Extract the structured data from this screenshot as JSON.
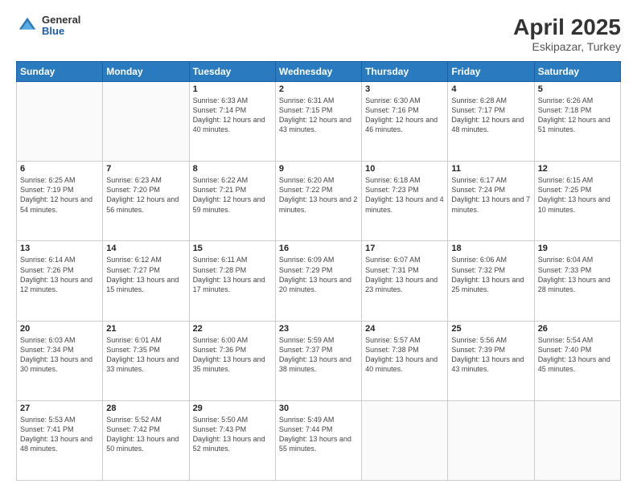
{
  "header": {
    "logo_general": "General",
    "logo_blue": "Blue",
    "title": "April 2025",
    "location": "Eskipazar, Turkey"
  },
  "days_of_week": [
    "Sunday",
    "Monday",
    "Tuesday",
    "Wednesday",
    "Thursday",
    "Friday",
    "Saturday"
  ],
  "weeks": [
    [
      {
        "day": "",
        "sunrise": "",
        "sunset": "",
        "daylight": ""
      },
      {
        "day": "",
        "sunrise": "",
        "sunset": "",
        "daylight": ""
      },
      {
        "day": "1",
        "sunrise": "Sunrise: 6:33 AM",
        "sunset": "Sunset: 7:14 PM",
        "daylight": "Daylight: 12 hours and 40 minutes."
      },
      {
        "day": "2",
        "sunrise": "Sunrise: 6:31 AM",
        "sunset": "Sunset: 7:15 PM",
        "daylight": "Daylight: 12 hours and 43 minutes."
      },
      {
        "day": "3",
        "sunrise": "Sunrise: 6:30 AM",
        "sunset": "Sunset: 7:16 PM",
        "daylight": "Daylight: 12 hours and 46 minutes."
      },
      {
        "day": "4",
        "sunrise": "Sunrise: 6:28 AM",
        "sunset": "Sunset: 7:17 PM",
        "daylight": "Daylight: 12 hours and 48 minutes."
      },
      {
        "day": "5",
        "sunrise": "Sunrise: 6:26 AM",
        "sunset": "Sunset: 7:18 PM",
        "daylight": "Daylight: 12 hours and 51 minutes."
      }
    ],
    [
      {
        "day": "6",
        "sunrise": "Sunrise: 6:25 AM",
        "sunset": "Sunset: 7:19 PM",
        "daylight": "Daylight: 12 hours and 54 minutes."
      },
      {
        "day": "7",
        "sunrise": "Sunrise: 6:23 AM",
        "sunset": "Sunset: 7:20 PM",
        "daylight": "Daylight: 12 hours and 56 minutes."
      },
      {
        "day": "8",
        "sunrise": "Sunrise: 6:22 AM",
        "sunset": "Sunset: 7:21 PM",
        "daylight": "Daylight: 12 hours and 59 minutes."
      },
      {
        "day": "9",
        "sunrise": "Sunrise: 6:20 AM",
        "sunset": "Sunset: 7:22 PM",
        "daylight": "Daylight: 13 hours and 2 minutes."
      },
      {
        "day": "10",
        "sunrise": "Sunrise: 6:18 AM",
        "sunset": "Sunset: 7:23 PM",
        "daylight": "Daylight: 13 hours and 4 minutes."
      },
      {
        "day": "11",
        "sunrise": "Sunrise: 6:17 AM",
        "sunset": "Sunset: 7:24 PM",
        "daylight": "Daylight: 13 hours and 7 minutes."
      },
      {
        "day": "12",
        "sunrise": "Sunrise: 6:15 AM",
        "sunset": "Sunset: 7:25 PM",
        "daylight": "Daylight: 13 hours and 10 minutes."
      }
    ],
    [
      {
        "day": "13",
        "sunrise": "Sunrise: 6:14 AM",
        "sunset": "Sunset: 7:26 PM",
        "daylight": "Daylight: 13 hours and 12 minutes."
      },
      {
        "day": "14",
        "sunrise": "Sunrise: 6:12 AM",
        "sunset": "Sunset: 7:27 PM",
        "daylight": "Daylight: 13 hours and 15 minutes."
      },
      {
        "day": "15",
        "sunrise": "Sunrise: 6:11 AM",
        "sunset": "Sunset: 7:28 PM",
        "daylight": "Daylight: 13 hours and 17 minutes."
      },
      {
        "day": "16",
        "sunrise": "Sunrise: 6:09 AM",
        "sunset": "Sunset: 7:29 PM",
        "daylight": "Daylight: 13 hours and 20 minutes."
      },
      {
        "day": "17",
        "sunrise": "Sunrise: 6:07 AM",
        "sunset": "Sunset: 7:31 PM",
        "daylight": "Daylight: 13 hours and 23 minutes."
      },
      {
        "day": "18",
        "sunrise": "Sunrise: 6:06 AM",
        "sunset": "Sunset: 7:32 PM",
        "daylight": "Daylight: 13 hours and 25 minutes."
      },
      {
        "day": "19",
        "sunrise": "Sunrise: 6:04 AM",
        "sunset": "Sunset: 7:33 PM",
        "daylight": "Daylight: 13 hours and 28 minutes."
      }
    ],
    [
      {
        "day": "20",
        "sunrise": "Sunrise: 6:03 AM",
        "sunset": "Sunset: 7:34 PM",
        "daylight": "Daylight: 13 hours and 30 minutes."
      },
      {
        "day": "21",
        "sunrise": "Sunrise: 6:01 AM",
        "sunset": "Sunset: 7:35 PM",
        "daylight": "Daylight: 13 hours and 33 minutes."
      },
      {
        "day": "22",
        "sunrise": "Sunrise: 6:00 AM",
        "sunset": "Sunset: 7:36 PM",
        "daylight": "Daylight: 13 hours and 35 minutes."
      },
      {
        "day": "23",
        "sunrise": "Sunrise: 5:59 AM",
        "sunset": "Sunset: 7:37 PM",
        "daylight": "Daylight: 13 hours and 38 minutes."
      },
      {
        "day": "24",
        "sunrise": "Sunrise: 5:57 AM",
        "sunset": "Sunset: 7:38 PM",
        "daylight": "Daylight: 13 hours and 40 minutes."
      },
      {
        "day": "25",
        "sunrise": "Sunrise: 5:56 AM",
        "sunset": "Sunset: 7:39 PM",
        "daylight": "Daylight: 13 hours and 43 minutes."
      },
      {
        "day": "26",
        "sunrise": "Sunrise: 5:54 AM",
        "sunset": "Sunset: 7:40 PM",
        "daylight": "Daylight: 13 hours and 45 minutes."
      }
    ],
    [
      {
        "day": "27",
        "sunrise": "Sunrise: 5:53 AM",
        "sunset": "Sunset: 7:41 PM",
        "daylight": "Daylight: 13 hours and 48 minutes."
      },
      {
        "day": "28",
        "sunrise": "Sunrise: 5:52 AM",
        "sunset": "Sunset: 7:42 PM",
        "daylight": "Daylight: 13 hours and 50 minutes."
      },
      {
        "day": "29",
        "sunrise": "Sunrise: 5:50 AM",
        "sunset": "Sunset: 7:43 PM",
        "daylight": "Daylight: 13 hours and 52 minutes."
      },
      {
        "day": "30",
        "sunrise": "Sunrise: 5:49 AM",
        "sunset": "Sunset: 7:44 PM",
        "daylight": "Daylight: 13 hours and 55 minutes."
      },
      {
        "day": "",
        "sunrise": "",
        "sunset": "",
        "daylight": ""
      },
      {
        "day": "",
        "sunrise": "",
        "sunset": "",
        "daylight": ""
      },
      {
        "day": "",
        "sunrise": "",
        "sunset": "",
        "daylight": ""
      }
    ]
  ]
}
